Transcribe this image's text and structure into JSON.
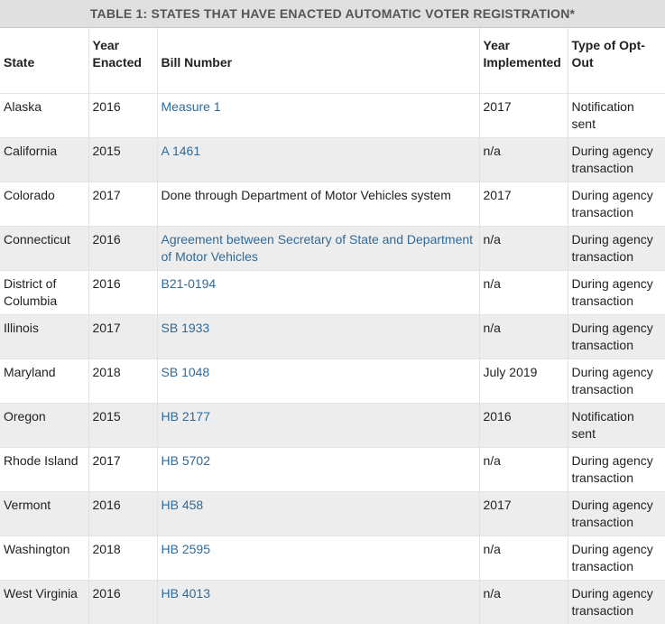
{
  "table": {
    "caption": "TABLE 1: STATES THAT HAVE ENACTED AUTOMATIC VOTER REGISTRATION*",
    "headers": {
      "state": "State",
      "year_enacted": "Year Enacted",
      "bill_number": "Bill Number",
      "year_implemented": "Year Implemented",
      "opt_out": "Type of Opt-Out"
    },
    "rows": [
      {
        "state": "Alaska",
        "year": "2016",
        "bill": "Measure 1",
        "bill_link": true,
        "implemented": "2017",
        "opt_out": "Notification sent"
      },
      {
        "state": "California",
        "year": "2015",
        "bill": "A 1461",
        "bill_link": true,
        "implemented": "n/a",
        "opt_out": "During agency transaction"
      },
      {
        "state": "Colorado",
        "year": "2017",
        "bill": "Done through Department of Motor Vehicles system",
        "bill_link": false,
        "implemented": "2017",
        "opt_out": "During agency transaction"
      },
      {
        "state": "Connecticut",
        "year": "2016",
        "bill": "Agreement between Secretary of State and Department of Motor Vehicles",
        "bill_link": true,
        "implemented": "n/a",
        "opt_out": "During agency transaction"
      },
      {
        "state": "District of Columbia",
        "year": "2016",
        "bill": "B21-0194",
        "bill_link": true,
        "implemented": "n/a",
        "opt_out": "During agency transaction"
      },
      {
        "state": "Illinois",
        "year": "2017",
        "bill": "SB 1933",
        "bill_link": true,
        "implemented": "n/a",
        "opt_out": "During agency transaction"
      },
      {
        "state": "Maryland",
        "year": "2018",
        "bill": "SB 1048",
        "bill_link": true,
        "implemented": "July 2019",
        "opt_out": "During agency transaction"
      },
      {
        "state": "Oregon",
        "year": "2015",
        "bill": "HB 2177",
        "bill_link": true,
        "implemented": "2016",
        "opt_out": "Notification sent"
      },
      {
        "state": "Rhode Island",
        "year": "2017",
        "bill": "HB 5702",
        "bill_link": true,
        "implemented": "n/a",
        "opt_out": "During agency transaction"
      },
      {
        "state": "Vermont",
        "year": "2016",
        "bill": "HB 458",
        "bill_link": true,
        "implemented": "2017",
        "opt_out": "During agency transaction"
      },
      {
        "state": "Washington",
        "year": "2018",
        "bill": "HB 2595",
        "bill_link": true,
        "implemented": "n/a",
        "opt_out": "During agency transaction"
      },
      {
        "state": "West Virginia",
        "year": "2016",
        "bill": "HB 4013",
        "bill_link": true,
        "implemented": "n/a",
        "opt_out": "During agency transaction"
      }
    ]
  },
  "colors": {
    "caption_bg": "#e0e0e0",
    "link": "#2f6a98",
    "row_stripe": "#ededed"
  }
}
